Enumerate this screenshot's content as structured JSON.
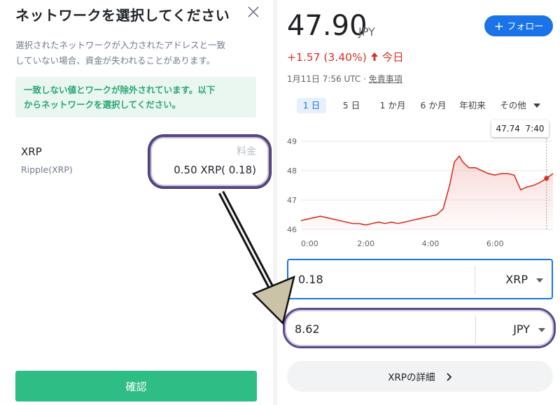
{
  "modal": {
    "title": "ネットワークを選択してください",
    "description_line1": "選択されたネットワークが入力されたアドレスと一致",
    "description_line2": "していない場合、資金が失われることがあります。",
    "warning_line1": "一致しない値とワークが除外されています。以下",
    "warning_line2": "からネットワークを選択してください。",
    "network": {
      "name": "XRP",
      "subtitle": "Ripple(XRP)",
      "fee_label": "料金",
      "fee_value": "0.50 XRP( 0.18)"
    },
    "confirm_label": "確認"
  },
  "quote": {
    "price": "47.90",
    "unit": "JPY",
    "follow_label": "フォロー",
    "change": "+1.57 (3.40%)",
    "change_suffix": "今日",
    "updated": "1月11日 7:56 UTC · ",
    "disclaimer": "免責事項",
    "ranges": [
      "1 日",
      "5 日",
      "1 か月",
      "6 か月",
      "年初来",
      "その他"
    ],
    "active_range": 0,
    "tooltip_value": "47.74",
    "tooltip_time": "7:40"
  },
  "chart_data": {
    "type": "line",
    "y_ticks": [
      "49",
      "48",
      "47",
      "46"
    ],
    "x_ticks": [
      "0:00",
      "2:00",
      "4:00",
      "6:00"
    ],
    "ylim": [
      46,
      49
    ],
    "xlim": [
      0,
      7.8
    ],
    "line_color": "#d93025",
    "x": [
      0,
      0.2,
      0.4,
      0.6,
      0.8,
      1.0,
      1.2,
      1.4,
      1.6,
      1.8,
      2.0,
      2.2,
      2.4,
      2.6,
      2.8,
      3.0,
      3.2,
      3.4,
      3.6,
      3.8,
      4.0,
      4.2,
      4.4,
      4.6,
      4.75,
      4.9,
      5.0,
      5.2,
      5.4,
      5.6,
      5.8,
      6.0,
      6.2,
      6.4,
      6.6,
      6.8,
      7.0,
      7.2,
      7.4,
      7.6,
      7.8
    ],
    "y": [
      46.3,
      46.35,
      46.4,
      46.45,
      46.4,
      46.35,
      46.3,
      46.25,
      46.2,
      46.2,
      46.15,
      46.2,
      46.25,
      46.2,
      46.25,
      46.2,
      46.25,
      46.3,
      46.35,
      46.4,
      46.45,
      46.5,
      46.7,
      47.5,
      48.3,
      48.5,
      48.3,
      48.1,
      48.1,
      48.0,
      47.9,
      47.85,
      47.9,
      47.9,
      47.85,
      47.35,
      47.45,
      47.5,
      47.6,
      47.74,
      47.9
    ],
    "marker": {
      "x": 7.6,
      "y": 47.74
    }
  },
  "converter": {
    "from_value": "0.18",
    "from_unit": "XRP",
    "to_value": "8.62",
    "to_unit": "JPY"
  },
  "details_label": "XRPの詳細"
}
